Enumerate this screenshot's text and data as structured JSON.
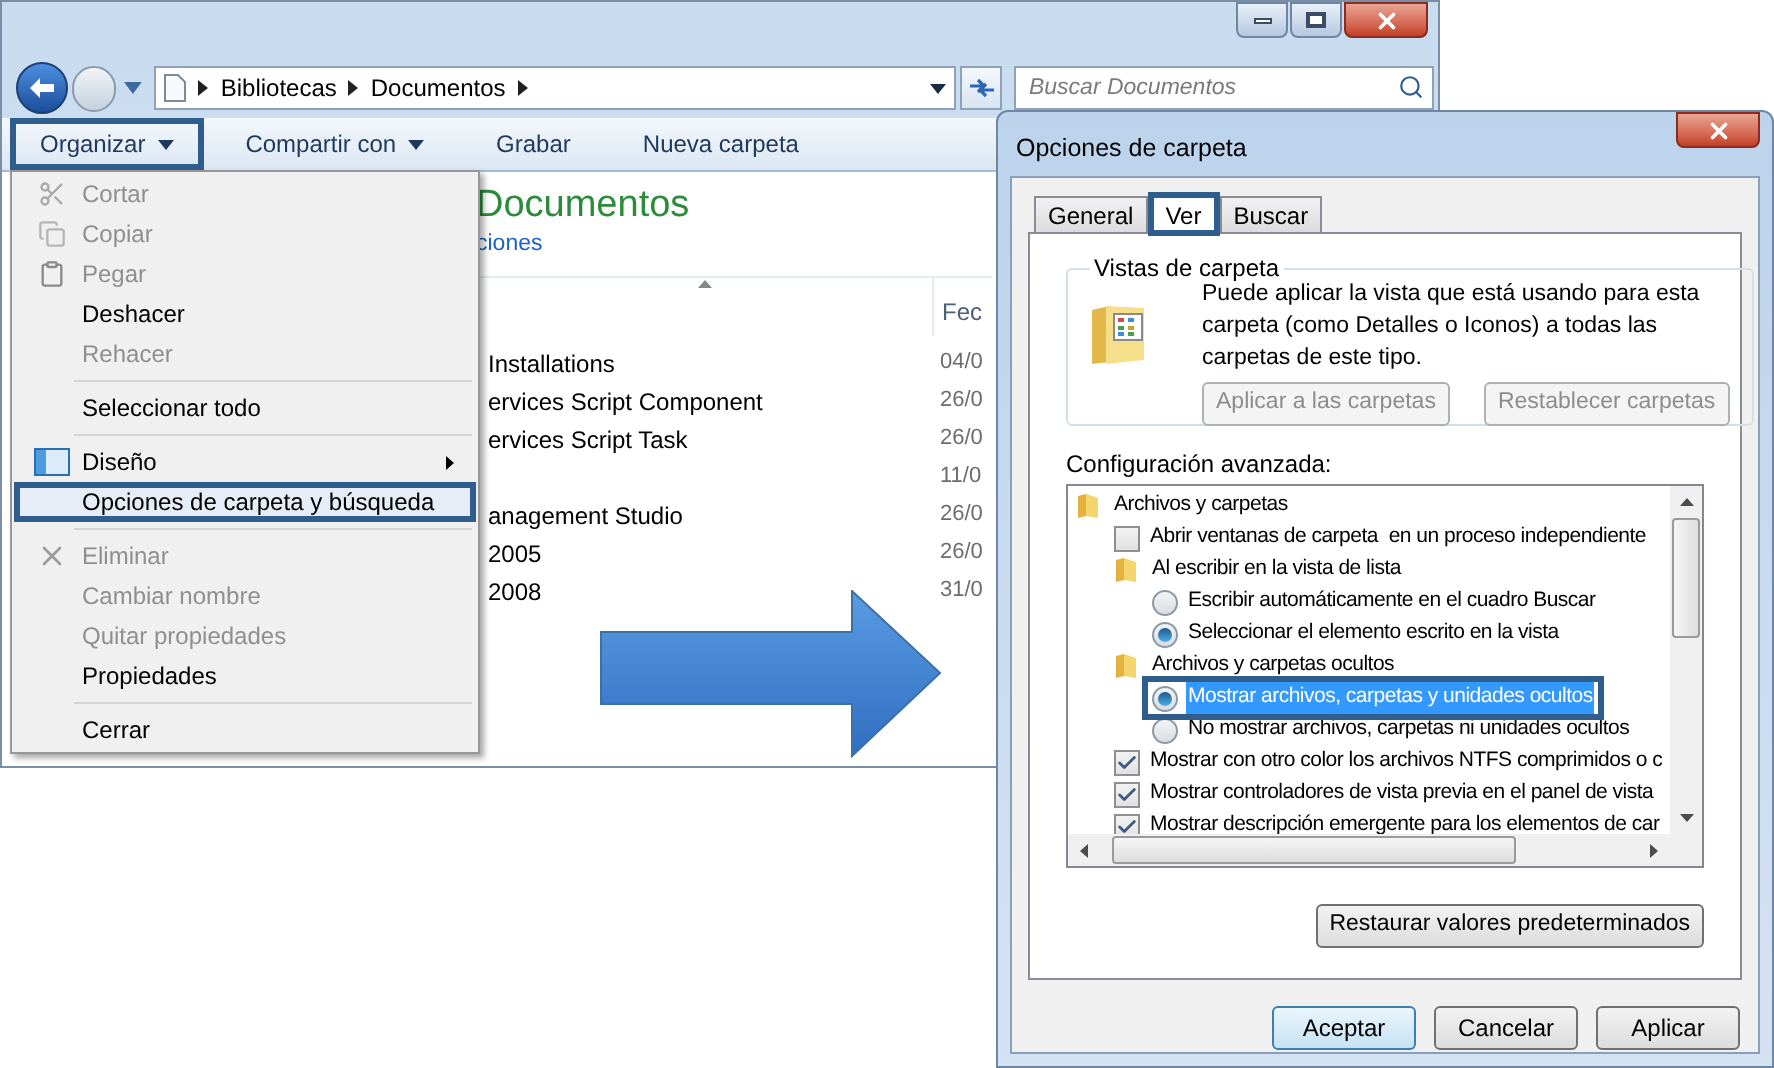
{
  "explorer": {
    "breadcrumb": [
      "Bibliotecas",
      "Documentos"
    ],
    "search": {
      "placeholder": "Buscar Documentos"
    },
    "toolbar": [
      {
        "label": "Organizar",
        "dropdown": true,
        "highlighted": true
      },
      {
        "label": "Compartir con",
        "dropdown": true,
        "highlighted": false
      },
      {
        "label": "Grabar",
        "dropdown": false,
        "highlighted": false
      },
      {
        "label": "Nueva carpeta",
        "dropdown": false,
        "highlighted": false
      }
    ],
    "library": {
      "title": "Documentos",
      "link": "ciones"
    },
    "columns": [
      "Fec"
    ],
    "rows": [
      {
        "name": "Installations",
        "date": "04/0"
      },
      {
        "name": "ervices Script Component",
        "date": "26/0"
      },
      {
        "name": "ervices Script Task",
        "date": "26/0"
      },
      {
        "date": "11/0"
      },
      {
        "name": "anagement Studio",
        "date": "26/0"
      },
      {
        "name": "2005",
        "date": "26/0"
      },
      {
        "name": "2008",
        "date": "31/0"
      }
    ]
  },
  "menu": {
    "items": [
      {
        "kind": "item",
        "label": "Cortar",
        "disabled": true,
        "highlighted": false
      },
      {
        "kind": "item",
        "label": "Copiar",
        "disabled": true,
        "highlighted": false
      },
      {
        "kind": "item",
        "label": "Pegar",
        "disabled": true,
        "highlighted": false
      },
      {
        "kind": "item",
        "label": "Deshacer",
        "disabled": false,
        "highlighted": false
      },
      {
        "kind": "item",
        "label": "Rehacer",
        "disabled": true,
        "highlighted": false
      },
      {
        "kind": "separator"
      },
      {
        "kind": "item",
        "label": "Seleccionar todo",
        "disabled": false,
        "highlighted": false
      },
      {
        "kind": "separator"
      },
      {
        "kind": "item",
        "label": "Diseño",
        "disabled": false,
        "highlighted": false,
        "submenu": true
      },
      {
        "kind": "item",
        "label": "Opciones de carpeta y búsqueda",
        "disabled": false,
        "highlighted": true
      },
      {
        "kind": "separator"
      },
      {
        "kind": "item",
        "label": "Eliminar",
        "disabled": true,
        "highlighted": false
      },
      {
        "kind": "item",
        "label": "Cambiar nombre",
        "disabled": true,
        "highlighted": false
      },
      {
        "kind": "item",
        "label": "Quitar propiedades",
        "disabled": true,
        "highlighted": false
      },
      {
        "kind": "item",
        "label": "Propiedades",
        "disabled": false,
        "highlighted": false
      },
      {
        "kind": "separator"
      },
      {
        "kind": "item",
        "label": "Cerrar",
        "disabled": false,
        "highlighted": false
      }
    ]
  },
  "dialog": {
    "title": "Opciones de carpeta",
    "tabs": [
      {
        "label": "General",
        "selected": false,
        "highlighted": false
      },
      {
        "label": "Ver",
        "selected": true,
        "highlighted": true
      },
      {
        "label": "Buscar",
        "selected": false,
        "highlighted": false
      }
    ],
    "folder_views": {
      "legend": "Vistas de carpeta",
      "description": "Puede aplicar la vista que está usando para esta carpeta (como Detalles o Iconos) a todas las carpetas de este tipo.",
      "buttons": [
        {
          "label": "Aplicar a las carpetas",
          "disabled": true
        },
        {
          "label": "Restablecer carpetas",
          "disabled": true
        }
      ]
    },
    "advanced": {
      "label": "Configuración avanzada:",
      "tree": [
        {
          "kind": "folder",
          "label": "Archivos y carpetas",
          "children": [
            {
              "kind": "checkbox",
              "label": "Abrir ventanas de carpeta  en un proceso independiente",
              "checked": false,
              "selected": false,
              "highlighted": false
            },
            {
              "kind": "folder",
              "label": "Al escribir en la vista de lista",
              "children": [
                {
                  "kind": "radio",
                  "label": "Escribir automáticamente en el cuadro Buscar",
                  "checked": false,
                  "selected": false,
                  "highlighted": false
                },
                {
                  "kind": "radio",
                  "label": "Seleccionar el elemento escrito en la vista",
                  "checked": true,
                  "selected": false,
                  "highlighted": false
                }
              ]
            },
            {
              "kind": "folder",
              "label": "Archivos y carpetas ocultos",
              "children": [
                {
                  "kind": "radio",
                  "label": "Mostrar archivos, carpetas y unidades ocultos",
                  "checked": true,
                  "selected": true,
                  "highlighted": true
                },
                {
                  "kind": "radio",
                  "label": "No mostrar archivos, carpetas ni unidades ocultos",
                  "checked": false,
                  "selected": false,
                  "highlighted": false
                }
              ]
            },
            {
              "kind": "checkbox",
              "label": "Mostrar con otro color los archivos NTFS comprimidos o c",
              "checked": true,
              "selected": false,
              "highlighted": false
            },
            {
              "kind": "checkbox",
              "label": "Mostrar controladores de vista previa en el panel de vista",
              "checked": true,
              "selected": false,
              "highlighted": false
            },
            {
              "kind": "checkbox",
              "label": "Mostrar descripción emergente para los elementos de car",
              "checked": true,
              "selected": false,
              "highlighted": false
            }
          ]
        }
      ]
    },
    "restore_button": "Restaurar valores predeterminados",
    "buttons": [
      {
        "label": "Aceptar",
        "default": true
      },
      {
        "label": "Cancelar",
        "default": false
      },
      {
        "label": "Aplicar",
        "default": false
      }
    ]
  }
}
